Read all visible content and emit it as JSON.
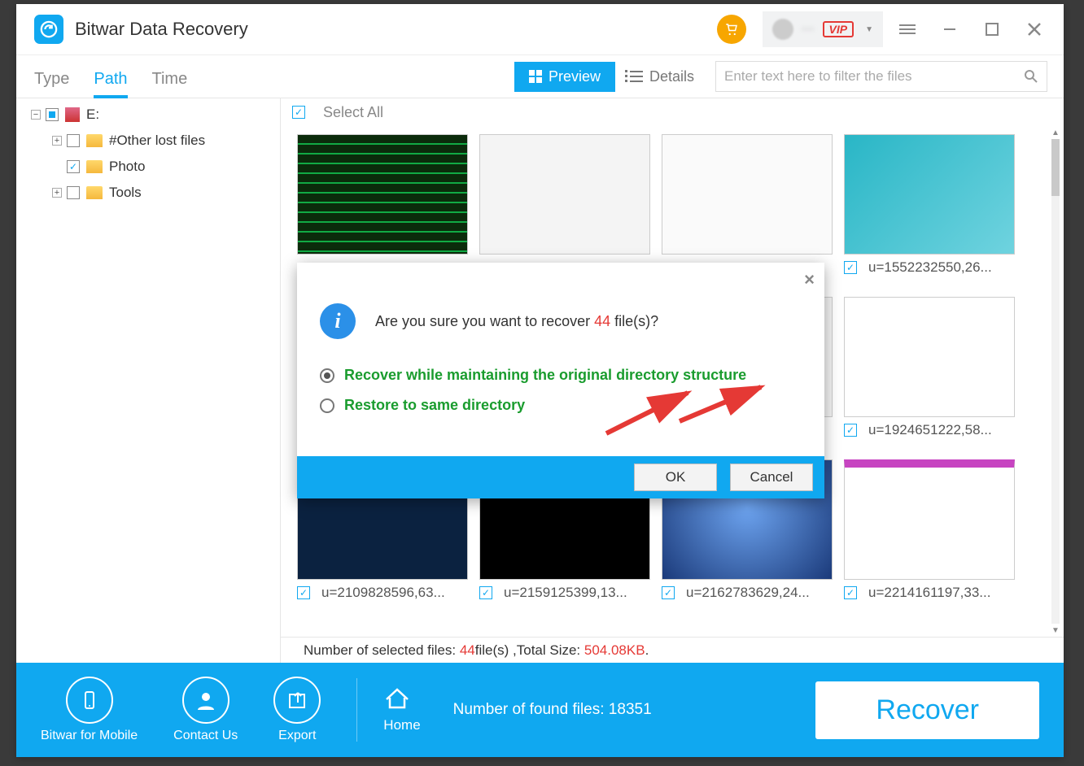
{
  "app": {
    "title": "Bitwar Data Recovery"
  },
  "titlebar": {
    "vip": "VIP",
    "username": "···"
  },
  "toolbar": {
    "tabs": {
      "type": "Type",
      "path": "Path",
      "time": "Time"
    },
    "preview": "Preview",
    "details": "Details",
    "filter_placeholder": "Enter text here to filter the files"
  },
  "tree": {
    "root": "E:",
    "other": "#Other lost files",
    "photo": "Photo",
    "tools": "Tools"
  },
  "grid": {
    "select_all": "Select All",
    "captions": {
      "r1c4": "u=1552232550,26...",
      "r2c4": "u=1924651222,58...",
      "r3c1": "u=2109828596,63...",
      "r3c2": "u=2159125399,13...",
      "r3c3": "u=2162783629,24...",
      "r3c4": "u=2214161197,33..."
    }
  },
  "status": {
    "prefix": "Number of selected files: ",
    "count": "44",
    "mid": "file(s) ,Total Size: ",
    "size": "504.08KB",
    "suffix": "."
  },
  "bottombar": {
    "mobile": "Bitwar for Mobile",
    "contact": "Contact Us",
    "export": "Export",
    "home": "Home",
    "found": "Number of found files: 18351",
    "recover": "Recover"
  },
  "modal": {
    "q_prefix": "Are you sure you want to recover ",
    "q_count": "44",
    "q_suffix": " file(s)?",
    "opt1": "Recover while maintaining the original directory structure",
    "opt2": "Restore to same directory",
    "ok": "OK",
    "cancel": "Cancel"
  }
}
